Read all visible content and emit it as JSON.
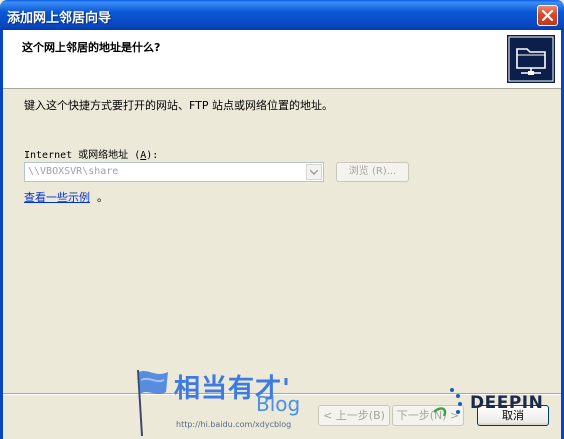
{
  "window": {
    "title": "添加网上邻居向导",
    "close_label": "×"
  },
  "header": {
    "title": "这个网上邻居的地址是什么?",
    "icon": "network-folder-icon"
  },
  "body": {
    "instruction": "键入这个快捷方式要打开的网站、FTP 站点或网络位置的地址。",
    "address_label_prefix": "Internet 或网络地址 (",
    "address_label_key": "A",
    "address_label_suffix": "):",
    "address_value": "\\\\VBOXSVR\\share",
    "browse_label": "浏览 (R)...",
    "examples_link": "查看一些示例",
    "examples_dot": "。"
  },
  "buttons": {
    "back": "< 上一步(B)",
    "next": "下一步(N) >",
    "cancel": "取消"
  },
  "watermark": {
    "cn_text": "相当有才'",
    "blog_text": "Blog",
    "url_text": "http://hi.baidu.com/xdycblog",
    "deepin_text": "DEEPIN"
  },
  "colors": {
    "titlebar": "#0a58d6",
    "dialog_bg": "#ece9d8",
    "link": "#0033cc"
  }
}
